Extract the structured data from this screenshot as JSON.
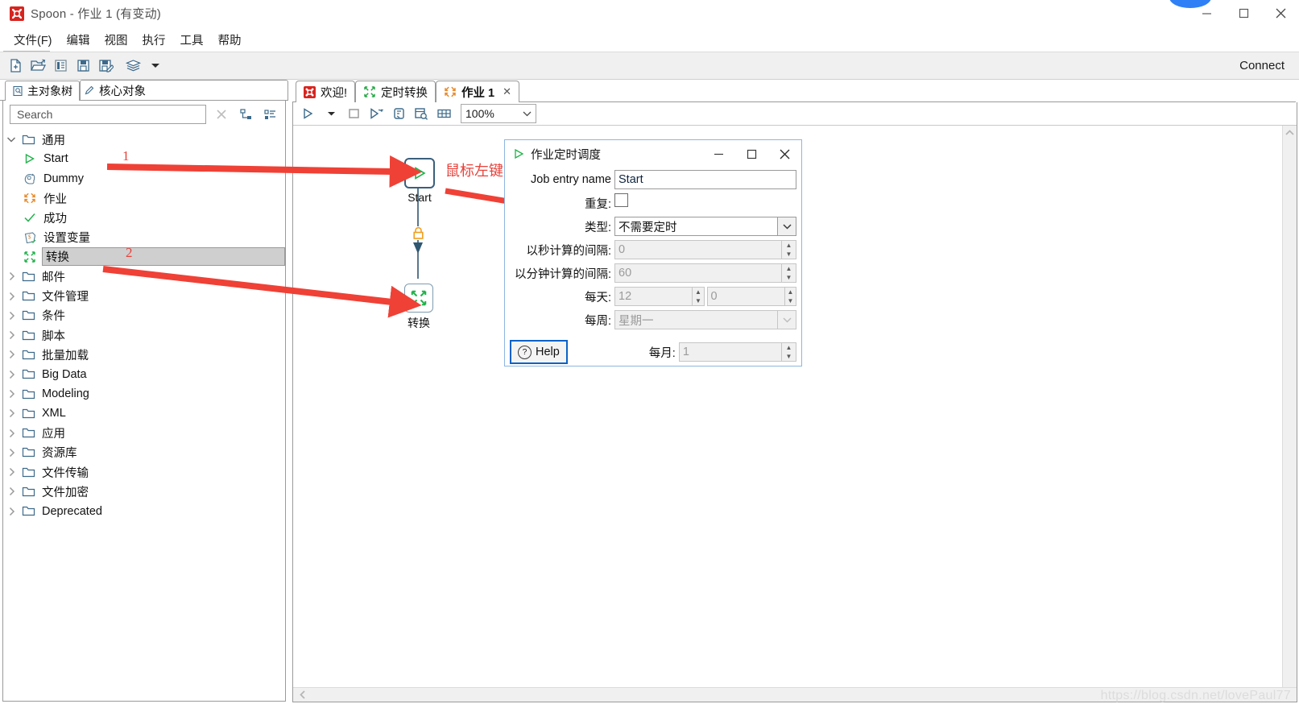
{
  "window": {
    "title": "Spoon - 作业 1 (有变动)",
    "app_icon": "spoon-icon",
    "minimize": "–",
    "maximize": "□",
    "close": "✕"
  },
  "menubar": {
    "items": [
      {
        "label": "文件(F)",
        "name": "menu-file"
      },
      {
        "label": "编辑",
        "name": "menu-edit"
      },
      {
        "label": "视图",
        "name": "menu-view"
      },
      {
        "label": "执行",
        "name": "menu-run"
      },
      {
        "label": "工具",
        "name": "menu-tools"
      },
      {
        "label": "帮助",
        "name": "menu-help"
      }
    ]
  },
  "toolbar": {
    "buttons": [
      {
        "name": "new-file-icon"
      },
      {
        "name": "open-folder-icon"
      },
      {
        "name": "explorer-icon"
      },
      {
        "name": "save-icon"
      },
      {
        "name": "save-as-icon"
      },
      {
        "name": "layers-icon"
      },
      {
        "name": "chevron-down-icon"
      }
    ],
    "connect_label": "Connect"
  },
  "left_panel": {
    "tabs": [
      {
        "label": "主对象树",
        "name": "tab-main-object-tree",
        "selected": false
      },
      {
        "label": "核心对象",
        "name": "tab-core-objects",
        "selected": true
      }
    ],
    "search": {
      "value": "",
      "placeholder": "Search"
    },
    "tree_tools": [
      {
        "name": "expand-tree-icon"
      },
      {
        "name": "collapse-tree-icon"
      }
    ],
    "tree": [
      {
        "label": "通用",
        "type": "folder",
        "expanded": true,
        "twisty": "v",
        "indent": 0
      },
      {
        "label": "Start",
        "type": "item",
        "icon": "start-triangle-icon",
        "indent": 1
      },
      {
        "label": "Dummy",
        "type": "item",
        "icon": "dummy-icon",
        "indent": 1
      },
      {
        "label": "作业",
        "type": "item",
        "icon": "job-icon",
        "indent": 1
      },
      {
        "label": "成功",
        "type": "item",
        "icon": "check-icon",
        "indent": 1
      },
      {
        "label": "设置变量",
        "type": "item",
        "icon": "set-variable-icon",
        "indent": 1
      },
      {
        "label": "转换",
        "type": "item",
        "icon": "transform-icon",
        "indent": 1,
        "selected": true
      },
      {
        "label": "邮件",
        "type": "folder",
        "expanded": false,
        "twisty": ">",
        "indent": 0
      },
      {
        "label": "文件管理",
        "type": "folder",
        "expanded": false,
        "twisty": ">",
        "indent": 0
      },
      {
        "label": "条件",
        "type": "folder",
        "expanded": false,
        "twisty": ">",
        "indent": 0
      },
      {
        "label": "脚本",
        "type": "folder",
        "expanded": false,
        "twisty": ">",
        "indent": 0
      },
      {
        "label": "批量加载",
        "type": "folder",
        "expanded": false,
        "twisty": ">",
        "indent": 0
      },
      {
        "label": "Big Data",
        "type": "folder",
        "expanded": false,
        "twisty": ">",
        "indent": 0
      },
      {
        "label": "Modeling",
        "type": "folder",
        "expanded": false,
        "twisty": ">",
        "indent": 0
      },
      {
        "label": "XML",
        "type": "folder",
        "expanded": false,
        "twisty": ">",
        "indent": 0
      },
      {
        "label": "应用",
        "type": "folder",
        "expanded": false,
        "twisty": ">",
        "indent": 0
      },
      {
        "label": "资源库",
        "type": "folder",
        "expanded": false,
        "twisty": ">",
        "indent": 0
      },
      {
        "label": "文件传输",
        "type": "folder",
        "expanded": false,
        "twisty": ">",
        "indent": 0
      },
      {
        "label": "文件加密",
        "type": "folder",
        "expanded": false,
        "twisty": ">",
        "indent": 0
      },
      {
        "label": "Deprecated",
        "type": "folder",
        "expanded": false,
        "twisty": ">",
        "indent": 0
      }
    ]
  },
  "editor": {
    "tabs": [
      {
        "label": "欢迎!",
        "name": "tab-welcome",
        "icon": "spoon-icon",
        "active": false,
        "closable": false
      },
      {
        "label": "定时转换",
        "name": "tab-scheduled-transform",
        "icon": "transform-icon",
        "active": false,
        "closable": false
      },
      {
        "label": "作业 1",
        "name": "tab-job-1",
        "icon": "job-icon",
        "active": true,
        "closable": true,
        "close": "✕"
      }
    ],
    "canvas_toolbar": [
      {
        "name": "run-icon"
      },
      {
        "name": "run-dropdown-icon"
      },
      {
        "name": "stop-icon"
      },
      {
        "name": "preview-icon"
      },
      {
        "name": "debug-icon"
      },
      {
        "name": "inspect-icon"
      },
      {
        "name": "grid-icon"
      }
    ],
    "zoom": {
      "value": "100%",
      "chevron": "chevron-down-icon"
    },
    "nodes": [
      {
        "name": "node-start",
        "label": "Start",
        "icon": "start-triangle-icon"
      },
      {
        "name": "node-transform",
        "label": "转换",
        "icon": "transform-icon"
      }
    ],
    "hop": {
      "lock_icon": "lock-icon"
    },
    "scrollbars": {
      "h_arrow": "chevron-left-icon",
      "v_arrow": "chevron-up-icon"
    }
  },
  "annotations": {
    "double_click_text": "鼠标左键双击",
    "marker_1": "1",
    "marker_2": "2",
    "arrow_color": "#ef4136"
  },
  "dialog": {
    "title": "作业定时调度",
    "title_icon": "start-triangle-icon",
    "minimize": "–",
    "maximize": "□",
    "close": "✕",
    "fields": [
      {
        "label": "Job entry name",
        "name": "job-entry-name-field",
        "value": "Start",
        "control": "text",
        "enabled": true
      },
      {
        "label": "重复:",
        "name": "repeat-checkbox",
        "value": "",
        "control": "checkbox",
        "enabled": true,
        "checked": false
      },
      {
        "label": "类型:",
        "name": "type-select",
        "value": "不需要定时",
        "control": "select",
        "enabled": true
      },
      {
        "label": "以秒计算的间隔:",
        "name": "interval-seconds-field",
        "value": "0",
        "control": "spinner",
        "enabled": false
      },
      {
        "label": "以分钟计算的间隔:",
        "name": "interval-minutes-field",
        "value": "60",
        "control": "spinner",
        "enabled": false
      },
      {
        "label": "每天:",
        "name": "daily-hour-field",
        "value": "12",
        "value2": "0",
        "control": "spinner2",
        "enabled": false
      },
      {
        "label": "每周:",
        "name": "weekly-select",
        "value": "星期一",
        "control": "select",
        "enabled": false
      },
      {
        "label": "每月:",
        "name": "monthly-field",
        "value": "1",
        "control": "spinner",
        "enabled": false
      }
    ],
    "help_button": {
      "label": "Help",
      "icon": "question-icon"
    }
  },
  "watermark": "https://blog.csdn.net/lovePaul77"
}
